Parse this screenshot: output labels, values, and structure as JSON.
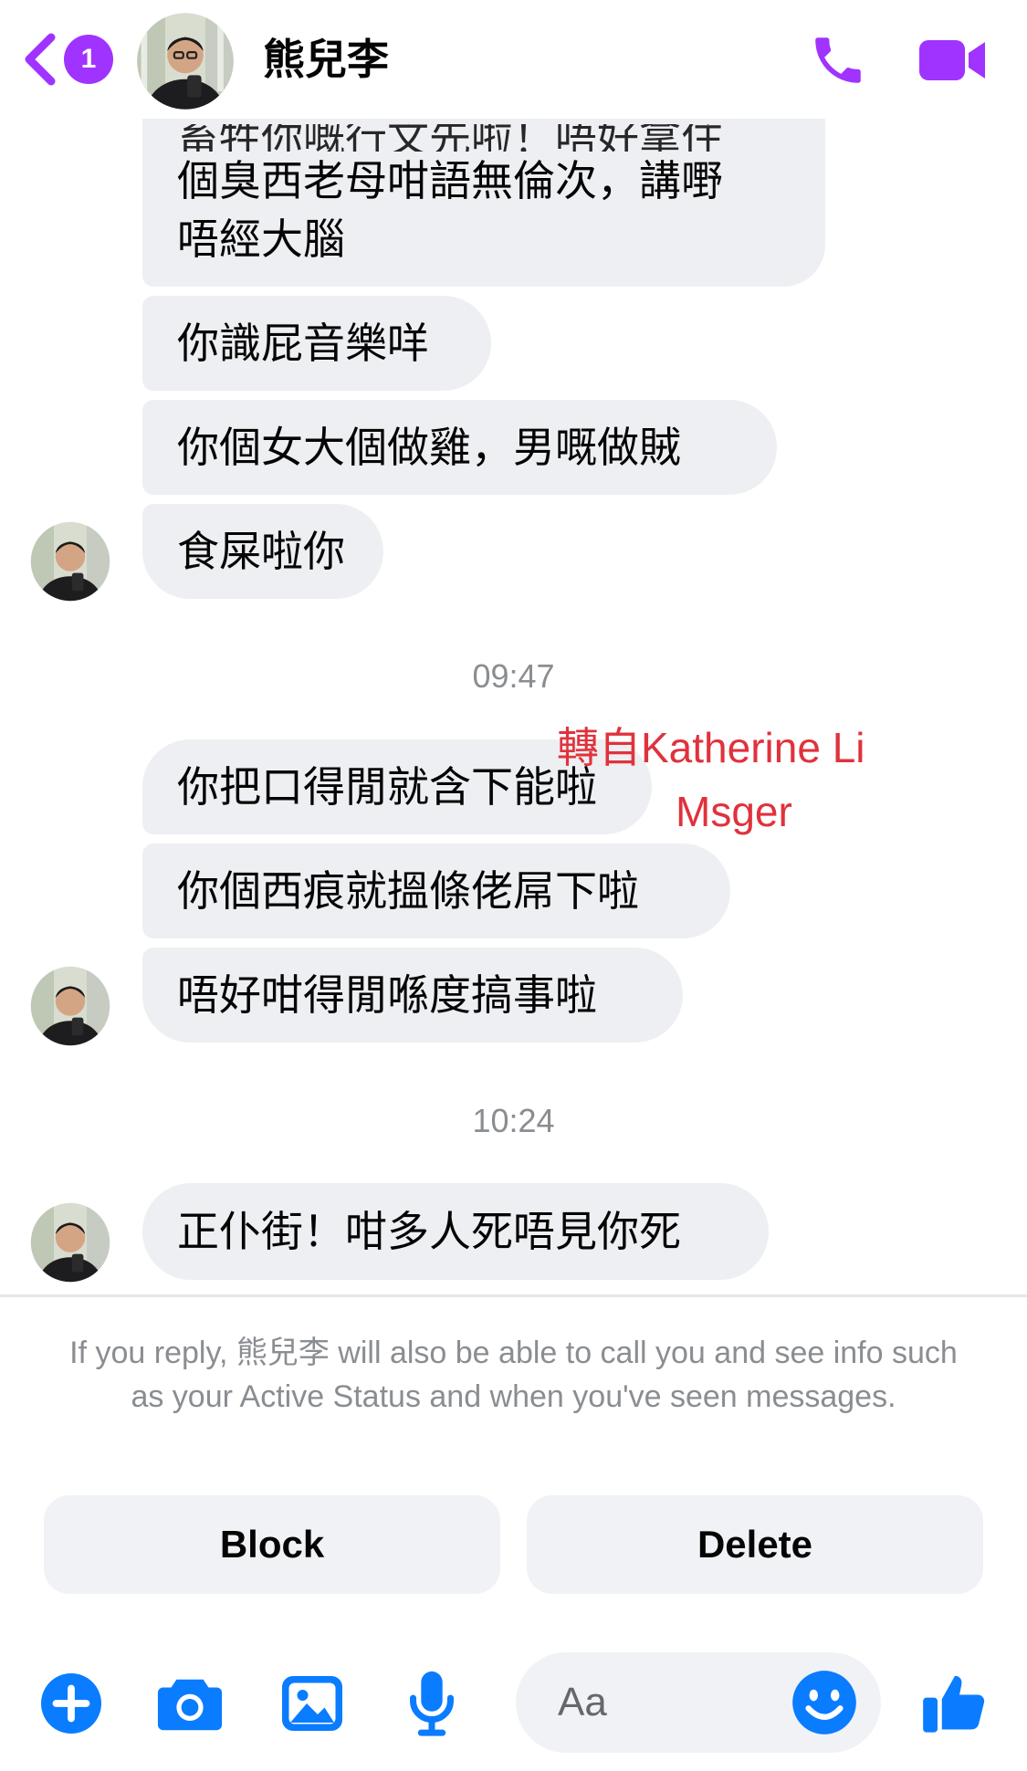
{
  "header": {
    "contact_name": "熊兒李",
    "unread_count": "1"
  },
  "messages": {
    "m1_line1": "畜牲你嘅行文先啦！唔好拿住",
    "m1_line2": "個臭西老母咁語無倫次，講嘢",
    "m1_line3": "唔經大腦",
    "m2": "你識屁音樂咩",
    "m3": "你個女大個做雞，男嘅做賊",
    "m4": "食屎啦你",
    "time1": "09:47",
    "m5": "你把口得閒就含下能啦",
    "m6": "你個西痕就搵條佬屌下啦",
    "m7": "唔好咁得閒喺度搞事啦",
    "time2": "10:24",
    "m8": "正仆街！咁多人死唔見你死"
  },
  "watermark": {
    "line1": "轉自Katherine Li",
    "line2": "Msger"
  },
  "request_panel": {
    "notice": "If you reply, 熊兒李 will also be able to call you and see info such as your Active Status and when you've seen messages.",
    "block_label": "Block",
    "delete_label": "Delete"
  },
  "composer": {
    "placeholder": "Aa"
  },
  "colors": {
    "header_accent": "#a033ff",
    "composer_accent": "#0a7cff",
    "bubble_bg": "#eeeff2",
    "watermark": "#e0323c"
  },
  "icons": [
    "back-chevron-icon",
    "phone-icon",
    "video-camera-icon",
    "plus-icon",
    "camera-icon",
    "image-icon",
    "microphone-icon",
    "emoji-icon",
    "thumbs-up-icon"
  ]
}
